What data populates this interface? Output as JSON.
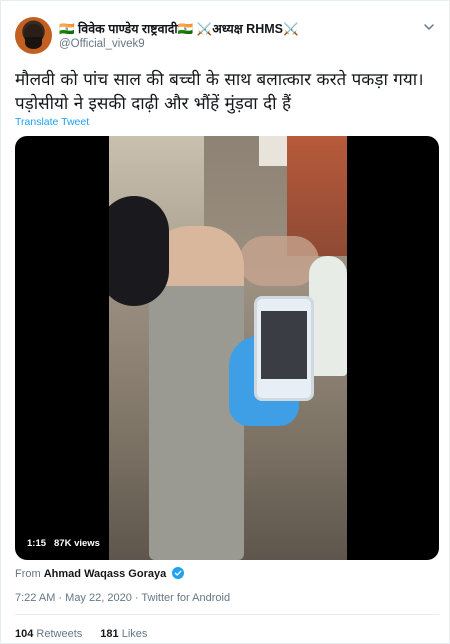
{
  "author": {
    "display_name": "🇮🇳 विवेक पाण्डेय राष्ट्रवादी🇮🇳 ⚔️अध्यक्ष RHMS⚔️",
    "handle": "@Official_vivek9"
  },
  "tweet": {
    "text": "मौलवी को पांच साल की बच्ची के साथ बलात्कार करते पकड़ा गया। पड़ोसीयो ने इसकी दाढ़ी और भौंहें मुंड़वा दी हैं",
    "translate_label": "Translate Tweet"
  },
  "video": {
    "duration": "1:15",
    "views": "87K views"
  },
  "source": {
    "prefix": "From",
    "name": "Ahmad Waqass Goraya"
  },
  "meta": {
    "time": "7:22 AM",
    "separator": "·",
    "date": "May 22, 2020",
    "client": "Twitter for Android"
  },
  "stats": {
    "retweets_count": "104",
    "retweets_label": "Retweets",
    "likes_count": "181",
    "likes_label": "Likes"
  },
  "colors": {
    "link": "#1da1f2",
    "muted": "#657786",
    "text": "#14171a",
    "border": "#e6ecf0"
  },
  "icons": [
    "chevron-down-icon",
    "verified-badge-icon"
  ]
}
